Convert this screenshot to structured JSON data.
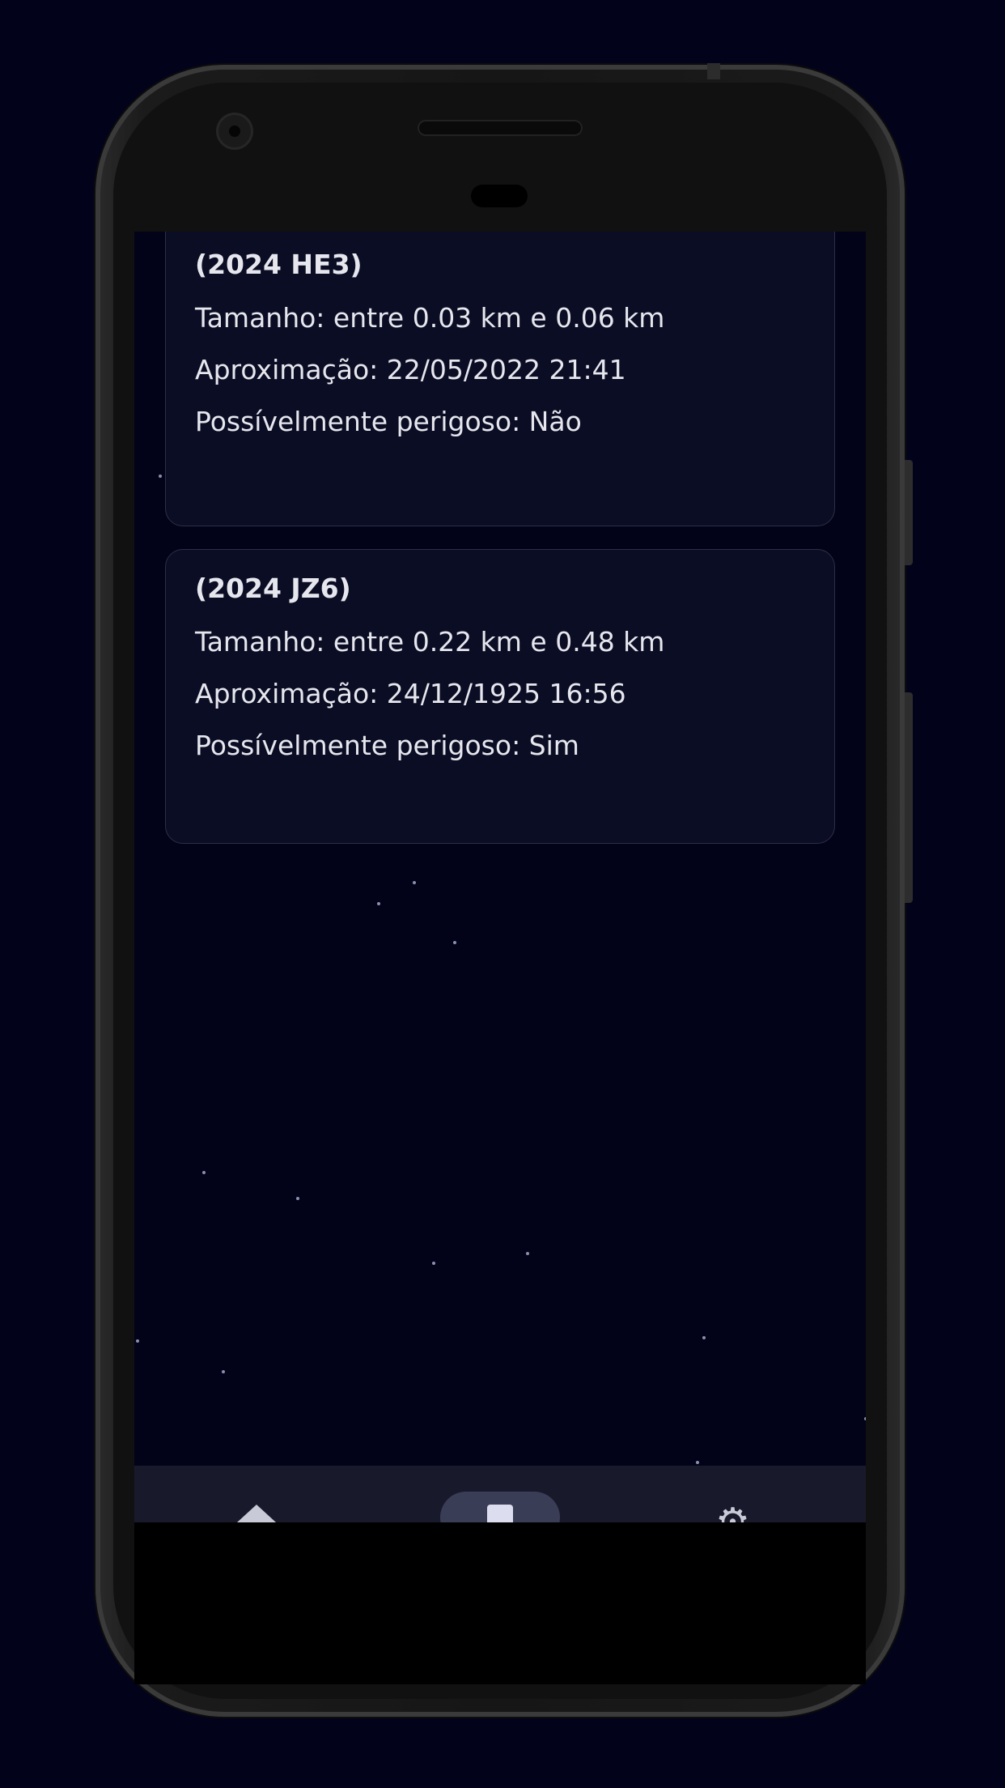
{
  "asteroids": [
    {
      "name": "(2024 HE3)",
      "size": "Tamanho: entre 0.03 km e 0.06 km",
      "approach": "Aproximação: 22/05/2022 21:41",
      "hazardous": "Possívelmente perigoso: Não"
    },
    {
      "name": "(2024 JZ6)",
      "size": "Tamanho: entre 0.22 km e 0.48 km",
      "approach": "Aproximação: 24/12/1925 16:56",
      "hazardous": "Possívelmente perigoso: Sim"
    }
  ],
  "bottom_nav": {
    "items": [
      {
        "icon": "home-icon",
        "selected": false
      },
      {
        "icon": "list-icon",
        "selected": true
      },
      {
        "icon": "gear-icon",
        "selected": false
      }
    ]
  },
  "colors": {
    "background": "#02031a",
    "card": "#0b0d24",
    "card_border": "#2c2f48",
    "text": "#e6e7ee",
    "nav_bar": "#181a2c",
    "nav_pill": "#3a3d56"
  }
}
